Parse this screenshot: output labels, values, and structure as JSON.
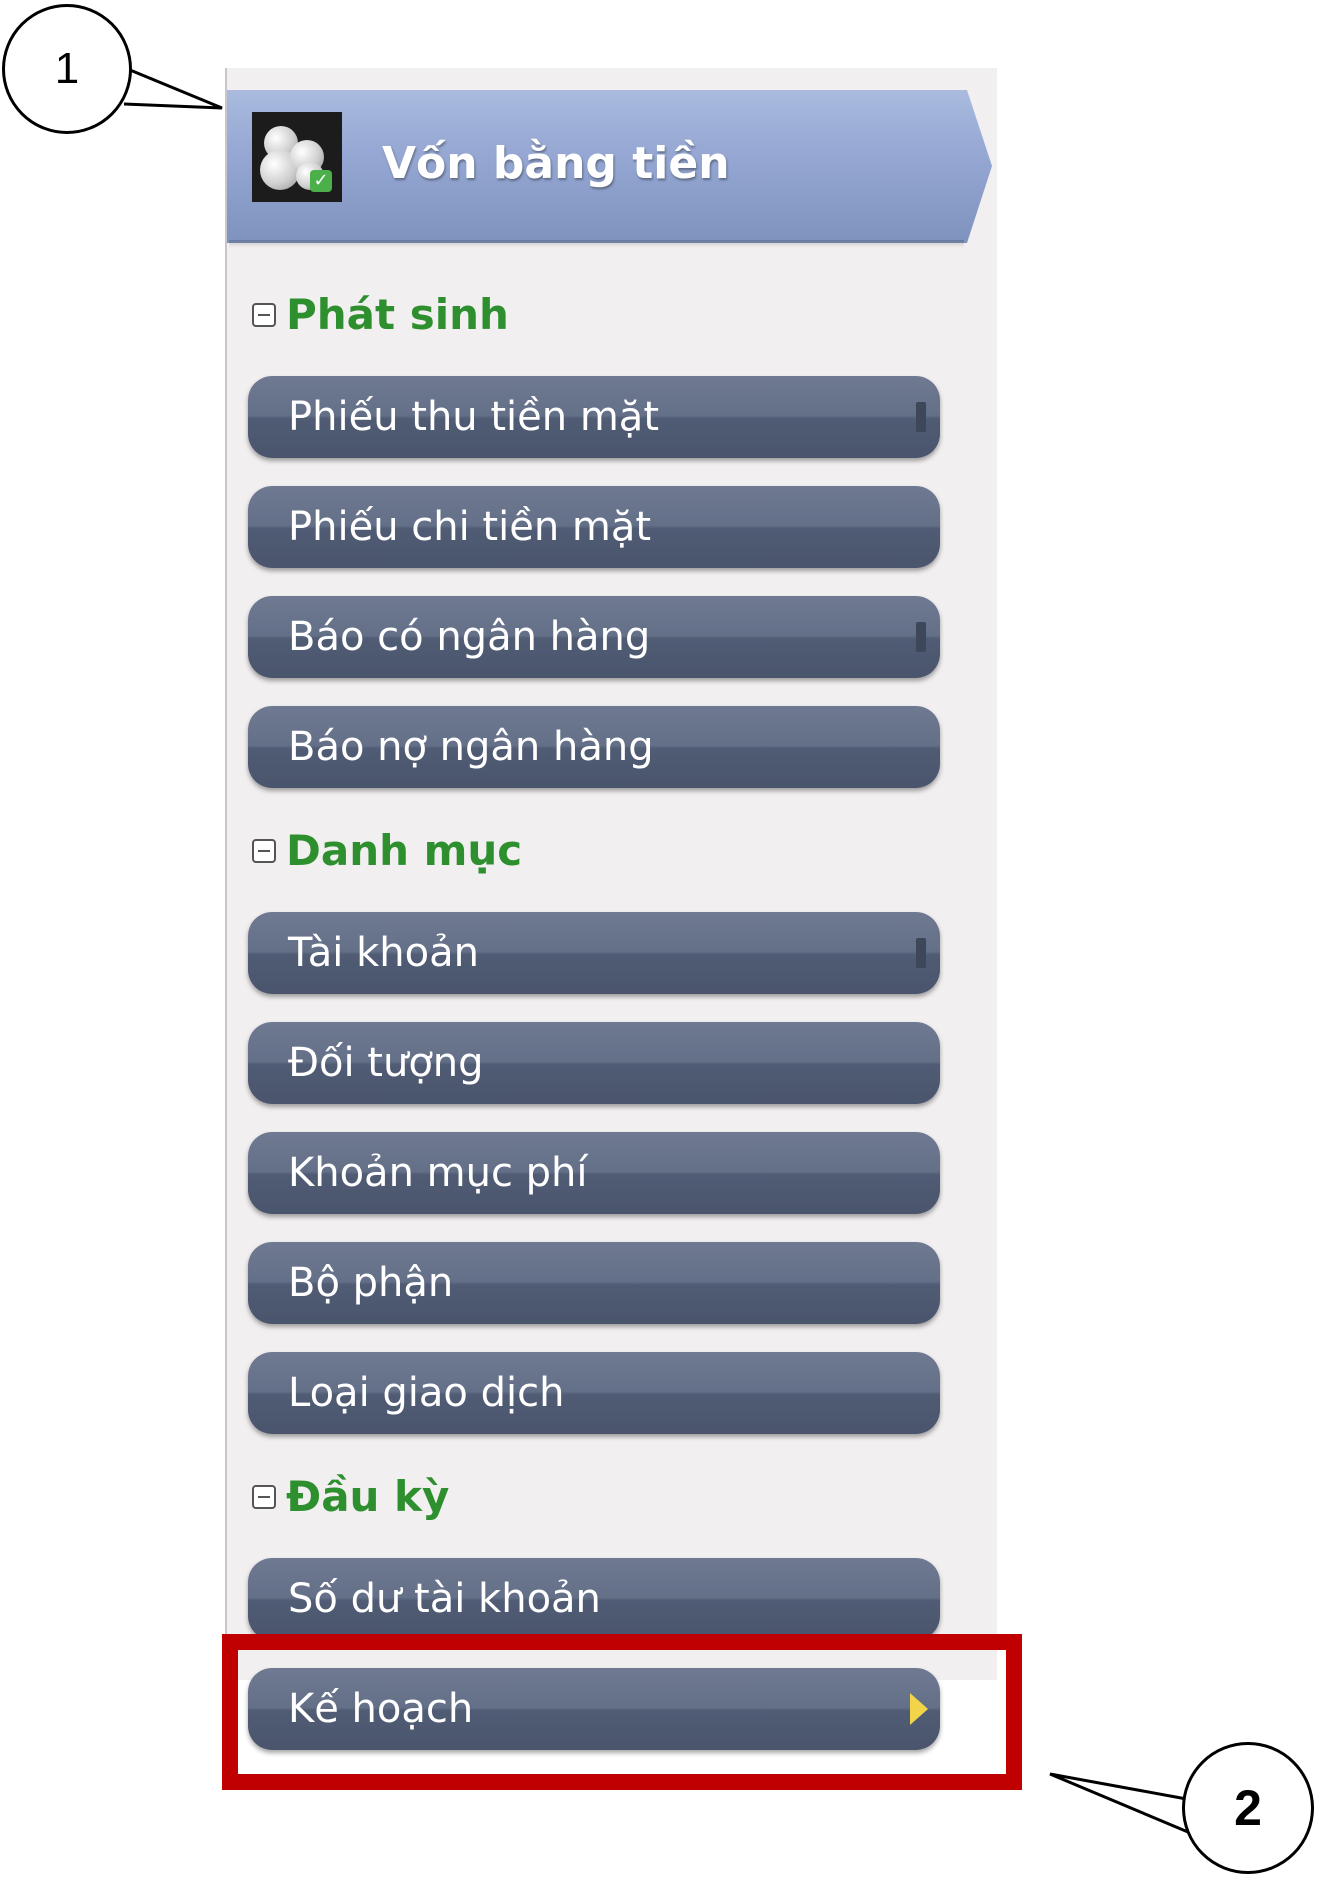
{
  "module": {
    "title": "Vốn bằng tiền",
    "icon": "coins-stack-icon"
  },
  "sections": [
    {
      "label": "Phát sinh",
      "items": [
        {
          "label": "Phiếu thu tiền mặt",
          "has_submenu_grip": true
        },
        {
          "label": "Phiếu chi tiền mặt",
          "has_submenu_grip": false
        },
        {
          "label": "Báo có ngân hàng",
          "has_submenu_grip": true
        },
        {
          "label": "Báo nợ ngân hàng",
          "has_submenu_grip": false
        }
      ]
    },
    {
      "label": "Danh mục",
      "items": [
        {
          "label": "Tài khoản",
          "has_submenu_grip": true
        },
        {
          "label": "Đối tượng",
          "has_submenu_grip": false
        },
        {
          "label": "Khoản mục phí",
          "has_submenu_grip": false
        },
        {
          "label": "Bộ phận",
          "has_submenu_grip": false
        },
        {
          "label": "Loại giao dịch",
          "has_submenu_grip": false
        }
      ]
    },
    {
      "label": "Đầu kỳ",
      "items": [
        {
          "label": "Số dư tài khoản",
          "has_submenu_grip": false
        },
        {
          "label": "Kế hoạch",
          "has_submenu_arrow": true
        }
      ]
    }
  ],
  "callouts": [
    {
      "number": "1"
    },
    {
      "number": "2"
    }
  ],
  "colors": {
    "section_label": "#2e8f2e",
    "highlight_box": "#c00000",
    "submenu_arrow": "#f1d44a"
  }
}
